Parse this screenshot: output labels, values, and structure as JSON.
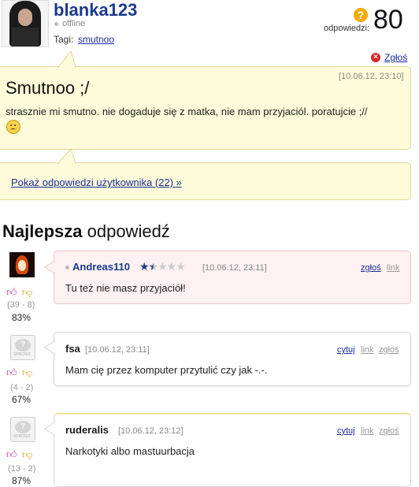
{
  "profile": {
    "username": "blanka123",
    "status": "offline",
    "tags_label": "Tagi:",
    "tag": "smutnoo",
    "answers_label": "odpowiedzi:",
    "answers_count": "80",
    "question_icon": "question-icon",
    "report_label": "Zgłoś"
  },
  "question": {
    "date": "[10.06.12, 23:10]",
    "title": "Smutnoo ;/",
    "body": "strasznie mi smutno. nie dogaduje się z matka, nie mam przyjaciól. poratujcie ;//",
    "emoji": "sad-face-icon"
  },
  "show_answers_link": "Pokaż odpowiedzi użytkownika (22) »",
  "best_answer": {
    "heading_bold": "Najlepsza",
    "heading_rest": " odpowiedź"
  },
  "answers": [
    {
      "user": "Andreas110",
      "date": "[10.06.12, 23:11]",
      "text": "Tu też nie masz przyjaciół!",
      "score": "(39 - 8)",
      "percent": "83%",
      "rating": 1.5,
      "actions": [
        "zgłoś",
        "link"
      ]
    },
    {
      "user": "fsa",
      "date": "[10.06.12, 23:11]",
      "text": "Mam cię przez komputer przytulić czy jak -.-.",
      "score": "(4 - 2)",
      "percent": "67%",
      "actions": [
        "cytuj",
        "link",
        "zgłoś"
      ]
    },
    {
      "user": "ruderalis",
      "date": "[10.06.12, 23:12]",
      "text": "Narkotyki albo mastuurbacja",
      "score": "(13 - 2)",
      "percent": "87%",
      "actions": [
        "cytuj",
        "link",
        "zgłoś"
      ]
    }
  ],
  "colors": {
    "username": "#1a3a8e",
    "link": "#1a2e9a",
    "question_bg": "#fdfbd9",
    "best_bg": "#fdf1f1",
    "thumb_up": "#c2309a",
    "thumb_down": "#d3a21a"
  }
}
